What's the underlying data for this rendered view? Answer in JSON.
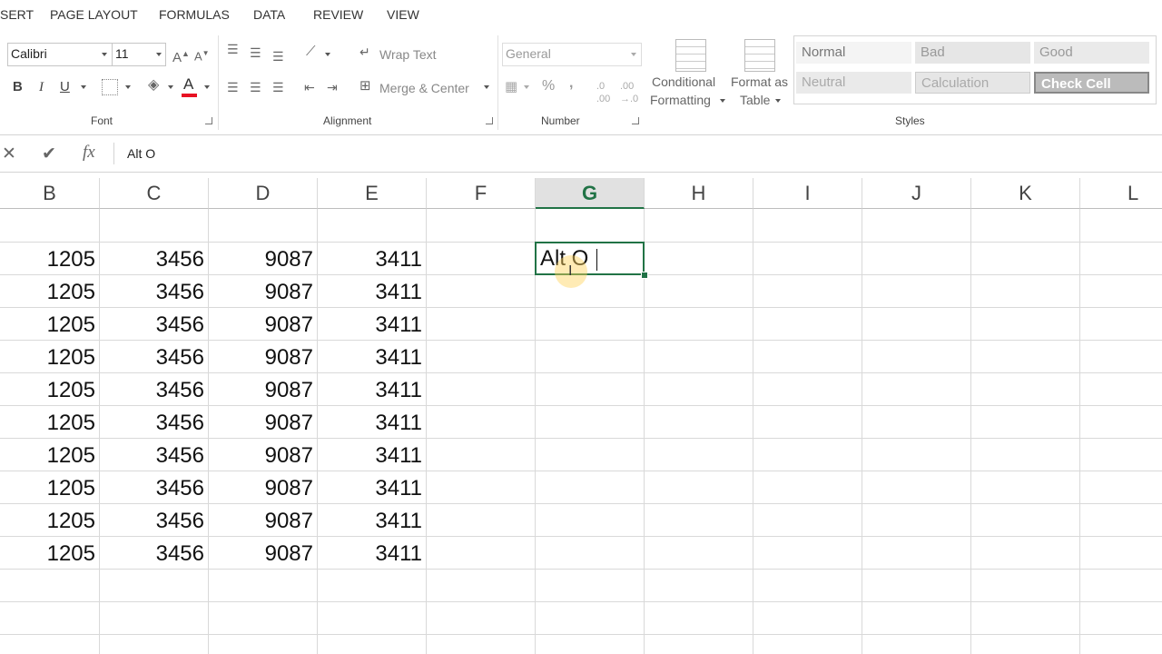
{
  "menu": {
    "tabs": [
      "SERT",
      "PAGE LAYOUT",
      "FORMULAS",
      "DATA",
      "REVIEW",
      "VIEW"
    ]
  },
  "ribbon": {
    "font": {
      "name": "Calibri",
      "size": "11",
      "bold": "B",
      "italic": "I",
      "underline": "U",
      "font_color_glyph": "A",
      "font_color": "#e81123",
      "label": "Font"
    },
    "alignment": {
      "wrap_text": "Wrap Text",
      "merge_center": "Merge & Center",
      "label": "Alignment"
    },
    "number": {
      "format": "General",
      "percent": "%",
      "comma": ",",
      "label": "Number"
    },
    "conditional_formatting": [
      "Conditional",
      "Formatting"
    ],
    "format_as_table": [
      "Format as",
      "Table"
    ],
    "styles": {
      "normal": "Normal",
      "bad": "Bad",
      "good": "Good",
      "neutral": "Neutral",
      "calculation": "Calculation",
      "check_cell": "Check Cell",
      "label": "Styles"
    }
  },
  "formula_bar": {
    "cancel": "✕",
    "enter": "✔",
    "fx": "fx",
    "content": "Alt O"
  },
  "grid": {
    "columns": [
      "B",
      "C",
      "D",
      "E",
      "F",
      "G",
      "H",
      "I",
      "J",
      "K",
      "L"
    ],
    "selected_column": "G",
    "rows": [
      [
        "1205",
        "3456",
        "9087",
        "3411"
      ],
      [
        "1205",
        "3456",
        "9087",
        "3411"
      ],
      [
        "1205",
        "3456",
        "9087",
        "3411"
      ],
      [
        "1205",
        "3456",
        "9087",
        "3411"
      ],
      [
        "1205",
        "3456",
        "9087",
        "3411"
      ],
      [
        "1205",
        "3456",
        "9087",
        "3411"
      ],
      [
        "1205",
        "3456",
        "9087",
        "3411"
      ],
      [
        "1205",
        "3456",
        "9087",
        "3411"
      ],
      [
        "1205",
        "3456",
        "9087",
        "3411"
      ],
      [
        "1205",
        "3456",
        "9087",
        "3411"
      ]
    ],
    "active_cell_value": "Alt O",
    "accent_color": "#217346"
  }
}
